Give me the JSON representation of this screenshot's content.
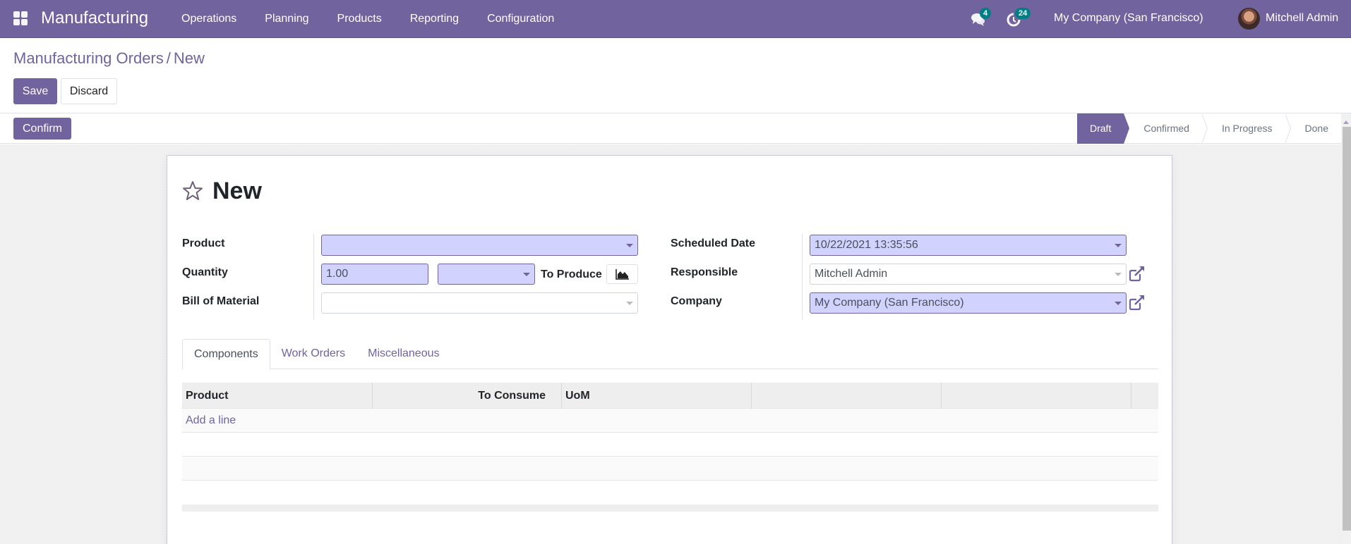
{
  "navbar": {
    "app_name": "Manufacturing",
    "menu": [
      "Operations",
      "Planning",
      "Products",
      "Reporting",
      "Configuration"
    ],
    "messages_count": "4",
    "activities_count": "24",
    "company": "My Company (San Francisco)",
    "user": "Mitchell Admin"
  },
  "breadcrumb": {
    "parent": "Manufacturing Orders",
    "separator": "/",
    "current": "New"
  },
  "control": {
    "save_label": "Save",
    "discard_label": "Discard",
    "confirm_label": "Confirm"
  },
  "status": {
    "steps": [
      "Draft",
      "Confirmed",
      "In Progress",
      "Done"
    ],
    "active": "Draft"
  },
  "record": {
    "title": "New",
    "fields": {
      "product": {
        "label": "Product",
        "value": ""
      },
      "quantity": {
        "label": "Quantity",
        "value": "1.00",
        "uom": "",
        "suffix": "To Produce"
      },
      "bom": {
        "label": "Bill of Material",
        "value": ""
      },
      "scheduled_date": {
        "label": "Scheduled Date",
        "value": "10/22/2021 13:35:56"
      },
      "responsible": {
        "label": "Responsible",
        "value": "Mitchell Admin"
      },
      "company": {
        "label": "Company",
        "value": "My Company (San Francisco)"
      }
    }
  },
  "tabs": [
    "Components",
    "Work Orders",
    "Miscellaneous"
  ],
  "active_tab": "Components",
  "components_table": {
    "columns": [
      "Product",
      "To Consume",
      "UoM",
      "",
      "",
      ""
    ],
    "add_line_label": "Add a line",
    "rows": []
  },
  "colors": {
    "brand": "#71639e",
    "required_bg": "#d2d2ff",
    "badge": "#017e84"
  }
}
